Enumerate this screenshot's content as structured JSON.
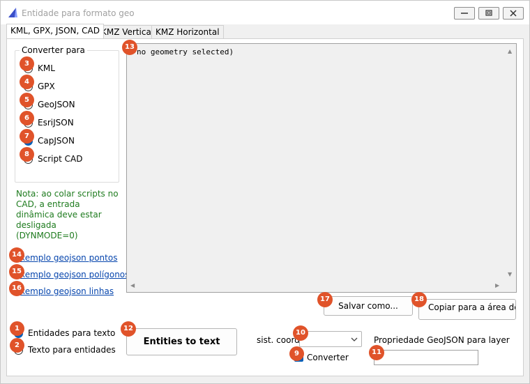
{
  "window": {
    "title": "Entidade para formato geo"
  },
  "tabs": [
    {
      "label": "KML, GPX, JSON, CAD",
      "active": true
    },
    {
      "label": "KMZ Vertical",
      "active": false
    },
    {
      "label": "KMZ Horizontal",
      "active": false
    }
  ],
  "convert_group": {
    "title": "Converter para",
    "options": [
      {
        "label": "KML",
        "checked": false
      },
      {
        "label": "GPX",
        "checked": false
      },
      {
        "label": "GeoJSON",
        "checked": false
      },
      {
        "label": "EsriJSON",
        "checked": false
      },
      {
        "label": "CapJSON",
        "checked": true
      },
      {
        "label": "Script CAD",
        "checked": false
      }
    ]
  },
  "note": "Nota: ao colar scripts no CAD, a entrada dinâmica deve estar desligada (DYNMODE=0)",
  "links": [
    {
      "label": "xemplo geojson pontos"
    },
    {
      "label": "xemplo geojson polígonos"
    },
    {
      "label": "xemplo geojson linhas"
    }
  ],
  "output_text": "no geometry selected)",
  "buttons": {
    "save": "Salvar como...",
    "copy": "Copiar para a área de",
    "convert": "Entities to text"
  },
  "direction": {
    "options": [
      {
        "label": "Entidades para texto",
        "checked": true
      },
      {
        "label": "Texto para entidades",
        "checked": false
      }
    ]
  },
  "coord_system": {
    "label": "sist. coord.",
    "value": ""
  },
  "convert_checkbox": {
    "label": "Converter",
    "checked": true
  },
  "layer_property": {
    "label": "Propriedade GeoJSON para layer",
    "value": ""
  },
  "badges": [
    "1",
    "2",
    "3",
    "4",
    "5",
    "6",
    "7",
    "8",
    "9",
    "10",
    "11",
    "12",
    "13",
    "14",
    "15",
    "16",
    "17",
    "18"
  ],
  "colors": {
    "accent": "#005fb8",
    "note_green": "#1e7b1e",
    "link_blue": "#0645ad",
    "badge": "#e0532a"
  }
}
